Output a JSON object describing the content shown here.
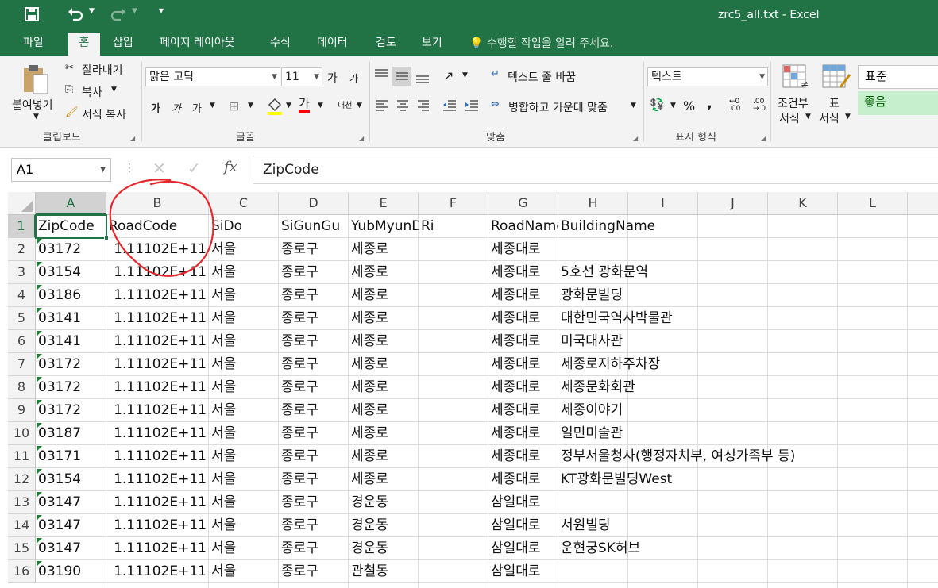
{
  "window": {
    "title": "zrc5_all.txt - Excel"
  },
  "tabs": [
    "파일",
    "홈",
    "삽입",
    "페이지 레이아웃",
    "수식",
    "데이터",
    "검토",
    "보기"
  ],
  "active_tab": "홈",
  "tell_me": "수행할 작업을 알려 주세요.",
  "ribbon": {
    "clipboard": {
      "paste": "붙여넣기",
      "cut": "잘라내기",
      "copy": "복사",
      "format_painter": "서식 복사",
      "label": "클립보드"
    },
    "font": {
      "name": "맑은 고딕",
      "size": "11",
      "grow": "가",
      "shrink": "가",
      "bold": "가",
      "italic": "가",
      "underline": "가",
      "font_color_glyph": "가",
      "phonetic": "내천",
      "label": "글꼴"
    },
    "alignment": {
      "wrap_text": "텍스트 줄 바꿈",
      "merge_center": "병합하고 가운데 맞춤",
      "label": "맞춤"
    },
    "number": {
      "format": "텍스트",
      "percent": "%",
      "comma": ",",
      "label": "표시 형식"
    },
    "styles": {
      "conditional_line1": "조건부",
      "conditional_line2": "서식",
      "table_line1": "표",
      "table_line2": "서식",
      "normal": "표준",
      "good": "좋음"
    }
  },
  "formula_bar": {
    "name_box": "A1",
    "fx": "fx",
    "content": "ZipCode"
  },
  "columns": [
    "A",
    "B",
    "C",
    "D",
    "E",
    "F",
    "G",
    "H",
    "I",
    "J",
    "K",
    "L"
  ],
  "rows": [
    {
      "num": "1",
      "cells": [
        "ZipCode",
        "RoadCode",
        "SiDo",
        "SiGunGu",
        "YubMyunDong",
        "Ri",
        "RoadName",
        "BuildingName"
      ]
    },
    {
      "num": "2",
      "cells": [
        "03172",
        "1.11102E+11",
        "서울",
        "종로구",
        "세종로",
        "",
        "세종대로",
        ""
      ]
    },
    {
      "num": "3",
      "cells": [
        "03154",
        "1.11102E+11",
        "서울",
        "종로구",
        "세종로",
        "",
        "세종대로",
        "5호선 광화문역"
      ]
    },
    {
      "num": "4",
      "cells": [
        "03186",
        "1.11102E+11",
        "서울",
        "종로구",
        "세종로",
        "",
        "세종대로",
        "광화문빌딩"
      ]
    },
    {
      "num": "5",
      "cells": [
        "03141",
        "1.11102E+11",
        "서울",
        "종로구",
        "세종로",
        "",
        "세종대로",
        "대한민국역사박물관"
      ]
    },
    {
      "num": "6",
      "cells": [
        "03141",
        "1.11102E+11",
        "서울",
        "종로구",
        "세종로",
        "",
        "세종대로",
        "미국대사관"
      ]
    },
    {
      "num": "7",
      "cells": [
        "03172",
        "1.11102E+11",
        "서울",
        "종로구",
        "세종로",
        "",
        "세종대로",
        "세종로지하주차장"
      ]
    },
    {
      "num": "8",
      "cells": [
        "03172",
        "1.11102E+11",
        "서울",
        "종로구",
        "세종로",
        "",
        "세종대로",
        "세종문화회관"
      ]
    },
    {
      "num": "9",
      "cells": [
        "03172",
        "1.11102E+11",
        "서울",
        "종로구",
        "세종로",
        "",
        "세종대로",
        "세종이야기"
      ]
    },
    {
      "num": "10",
      "cells": [
        "03187",
        "1.11102E+11",
        "서울",
        "종로구",
        "세종로",
        "",
        "세종대로",
        "일민미술관"
      ]
    },
    {
      "num": "11",
      "cells": [
        "03171",
        "1.11102E+11",
        "서울",
        "종로구",
        "세종로",
        "",
        "세종대로",
        "정부서울청사(행정자치부, 여성가족부 등)"
      ]
    },
    {
      "num": "12",
      "cells": [
        "03154",
        "1.11102E+11",
        "서울",
        "종로구",
        "세종로",
        "",
        "세종대로",
        "KT광화문빌딩West"
      ]
    },
    {
      "num": "13",
      "cells": [
        "03147",
        "1.11102E+11",
        "서울",
        "종로구",
        "경운동",
        "",
        "삼일대로",
        ""
      ]
    },
    {
      "num": "14",
      "cells": [
        "03147",
        "1.11102E+11",
        "서울",
        "종로구",
        "경운동",
        "",
        "삼일대로",
        "서원빌딩"
      ]
    },
    {
      "num": "15",
      "cells": [
        "03147",
        "1.11102E+11",
        "서울",
        "종로구",
        "경운동",
        "",
        "삼일대로",
        "운현궁SK허브"
      ]
    },
    {
      "num": "16",
      "cells": [
        "03190",
        "1.11102E+11",
        "서울",
        "종로구",
        "관철동",
        "",
        "삼일대로",
        ""
      ]
    }
  ],
  "colors": {
    "excel_green": "#217346",
    "annotation_red": "#e8262b",
    "good_style_bg": "#c6efce"
  }
}
